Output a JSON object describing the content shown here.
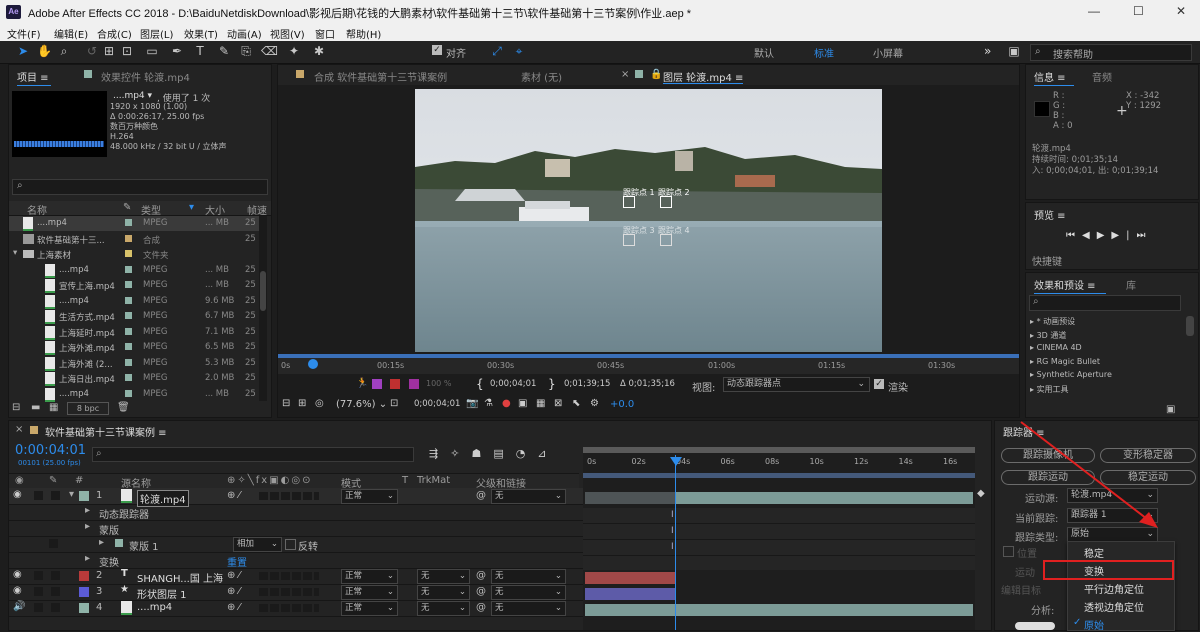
{
  "window": {
    "title": "Adobe After Effects CC 2018 - D:\\BaiduNetdiskDownload\\影视后期\\花钱的大鹏素材\\软件基础第十三节\\软件基础第十三节案例\\作业.aep *",
    "logo": "Ae",
    "min": "—",
    "max": "☐",
    "close": "✕"
  },
  "menu": [
    "文件(F)",
    "编辑(E)",
    "合成(C)",
    "图层(L)",
    "效果(T)",
    "动画(A)",
    "视图(V)",
    "窗口",
    "帮助(H)"
  ],
  "toolbar": {
    "align_label": "对齐",
    "workspaces": [
      "默认",
      "标准",
      "小屏幕"
    ],
    "active_workspace": "标准",
    "search_placeholder": "搜索帮助",
    "more": "»"
  },
  "project": {
    "tab_project": "项目",
    "tab_effects": "效果控件 轮渡.mp4",
    "file_name": "....mp4 ▾",
    "used": ", 使用了 1 次",
    "info_lines": [
      "1920 x 1080 (1.00)",
      "Δ 0:00:26:17, 25.00 fps",
      "数百万种颜色",
      "H.264",
      "48.000 kHz / 32 bit U / 立体声"
    ],
    "search_icon_label": "⌕",
    "columns": [
      "名称",
      "类型",
      "大小",
      "帧速"
    ],
    "rows": [
      {
        "name": "....mp4",
        "type": "MPEG",
        "size": "... MB",
        "fps": "25",
        "indent": 0,
        "kind": "video",
        "sel": true
      },
      {
        "name": "软件基础第十三...",
        "type": "合成",
        "size": "",
        "fps": "25",
        "indent": 0,
        "kind": "comp"
      },
      {
        "name": "上海素材",
        "type": "文件夹",
        "size": "",
        "fps": "",
        "indent": 0,
        "kind": "folder"
      },
      {
        "name": "....mp4",
        "type": "MPEG",
        "size": "... MB",
        "fps": "25",
        "indent": 1,
        "kind": "video"
      },
      {
        "name": "宣传上海.mp4",
        "type": "MPEG",
        "size": "... MB",
        "fps": "25",
        "indent": 1,
        "kind": "video"
      },
      {
        "name": "....mp4",
        "type": "MPEG",
        "size": "9.6 MB",
        "fps": "25",
        "indent": 1,
        "kind": "video"
      },
      {
        "name": "生活方式.mp4",
        "type": "MPEG",
        "size": "6.7 MB",
        "fps": "25",
        "indent": 1,
        "kind": "video"
      },
      {
        "name": "上海延时.mp4",
        "type": "MPEG",
        "size": "7.1 MB",
        "fps": "25",
        "indent": 1,
        "kind": "video"
      },
      {
        "name": "上海外滩.mp4",
        "type": "MPEG",
        "size": "6.5 MB",
        "fps": "25",
        "indent": 1,
        "kind": "video"
      },
      {
        "name": "上海外滩 (2...",
        "type": "MPEG",
        "size": "5.3 MB",
        "fps": "25",
        "indent": 1,
        "kind": "video"
      },
      {
        "name": "上海日出.mp4",
        "type": "MPEG",
        "size": "2.0 MB",
        "fps": "25",
        "indent": 1,
        "kind": "video"
      },
      {
        "name": "....mp4",
        "type": "MPEG",
        "size": "... MB",
        "fps": "25",
        "indent": 1,
        "kind": "video"
      }
    ],
    "bpc": "8 bpc"
  },
  "viewer": {
    "tab_comp": "合成 软件基础第十三节课案例",
    "tab_footage": "素材 (无)",
    "tab_layer": "图层 轮渡.mp4",
    "track_points": [
      "跟踪点 1",
      "跟踪点 2",
      "跟踪点 3",
      "跟踪点 4"
    ],
    "ruler": [
      "0s",
      "00:15s",
      "00:30s",
      "00:45s",
      "01:00s",
      "01:15s",
      "01:30s"
    ],
    "timecode_in": "0;00;04;01",
    "timecode_out": "0;01;39;15",
    "duration": "Δ 0;01;35;16",
    "view_label": "视图:",
    "view_value": "动态跟踪器点",
    "render_label": "渲染",
    "zoom": "(77.6%)",
    "current_time": "0;00;04;01",
    "exposure": "+0.0",
    "opacity": "100 %"
  },
  "info": {
    "tab_info": "信息",
    "tab_audio": "音频",
    "rgba": [
      "R :",
      "G :",
      "B :",
      "A : 0"
    ],
    "x": "X : -342",
    "y": "Y : 1292",
    "clip_name": "轮渡.mp4",
    "duration_line": "持续时间: 0;01;35;14",
    "inout_line": "入: 0;00;04;01, 出: 0;01;39;14"
  },
  "preview": {
    "tab": "预览",
    "shortcut": "快捷键"
  },
  "effects": {
    "tab_effects": "效果和预设",
    "tab_library": "库",
    "items": [
      "* 动画预设",
      "3D 通道",
      "CINEMA 4D",
      "RG Magic Bullet",
      "Synthetic Aperture",
      "实用工具"
    ]
  },
  "timeline": {
    "tab": "软件基础第十三节课案例",
    "timecode": "0:00:04:01",
    "frame_sub": "00101 (25.00 fps)",
    "search_placeholder": "",
    "col_source": "源名称",
    "col_mode": "模式",
    "col_t": "T",
    "col_trkmat": "TrkMat",
    "col_parent": "父级和链接",
    "layers": [
      {
        "num": "1",
        "name": "轮渡.mp4",
        "color": "#8fb3a8",
        "mode": "正常",
        "trk": "",
        "parent": "无",
        "type": "video"
      },
      {
        "num": "",
        "name": "动态跟踪器",
        "sub": 1
      },
      {
        "num": "",
        "name": "蒙版",
        "sub": 1
      },
      {
        "num": "",
        "name": "蒙版 1",
        "sub": 2,
        "mask_mode": "相加",
        "invert": "反转"
      },
      {
        "num": "",
        "name": "变换",
        "sub": 1,
        "reset": "重置"
      },
      {
        "num": "2",
        "name": "SHANGH...国 上海",
        "color": "#b83a3a",
        "mode": "正常",
        "trk": "无",
        "parent": "无",
        "type": "text"
      },
      {
        "num": "3",
        "name": "形状图层 1",
        "color": "#5b5bd6",
        "mode": "正常",
        "trk": "无",
        "parent": "无",
        "type": "shape"
      },
      {
        "num": "4",
        "name": "....mp4",
        "color": "#8fb3a8",
        "mode": "正常",
        "trk": "无",
        "parent": "无",
        "type": "video"
      }
    ],
    "ruler": [
      "0s",
      "02s",
      "04s",
      "06s",
      "08s",
      "10s",
      "12s",
      "14s",
      "16s"
    ]
  },
  "tracker": {
    "tab": "跟踪器",
    "btn_camera": "跟踪摄像机",
    "btn_warp": "变形稳定器",
    "btn_motion": "跟踪运动",
    "btn_stabilize": "稳定运动",
    "motion_source_label": "运动源:",
    "motion_source_value": "轮渡.mp4",
    "current_track_label": "当前跟踪:",
    "current_track_value": "跟踪器 1",
    "track_type_label": "跟踪类型:",
    "track_type_value": "原始",
    "analyze_label": "分析:",
    "partial": [
      "位置",
      "运动",
      "编辑目标"
    ],
    "dropdown": [
      "稳定",
      "变换",
      "平行边角定位",
      "透视边角定位",
      "原始"
    ],
    "dropdown_highlight": "变换",
    "dropdown_checked": "原始"
  }
}
